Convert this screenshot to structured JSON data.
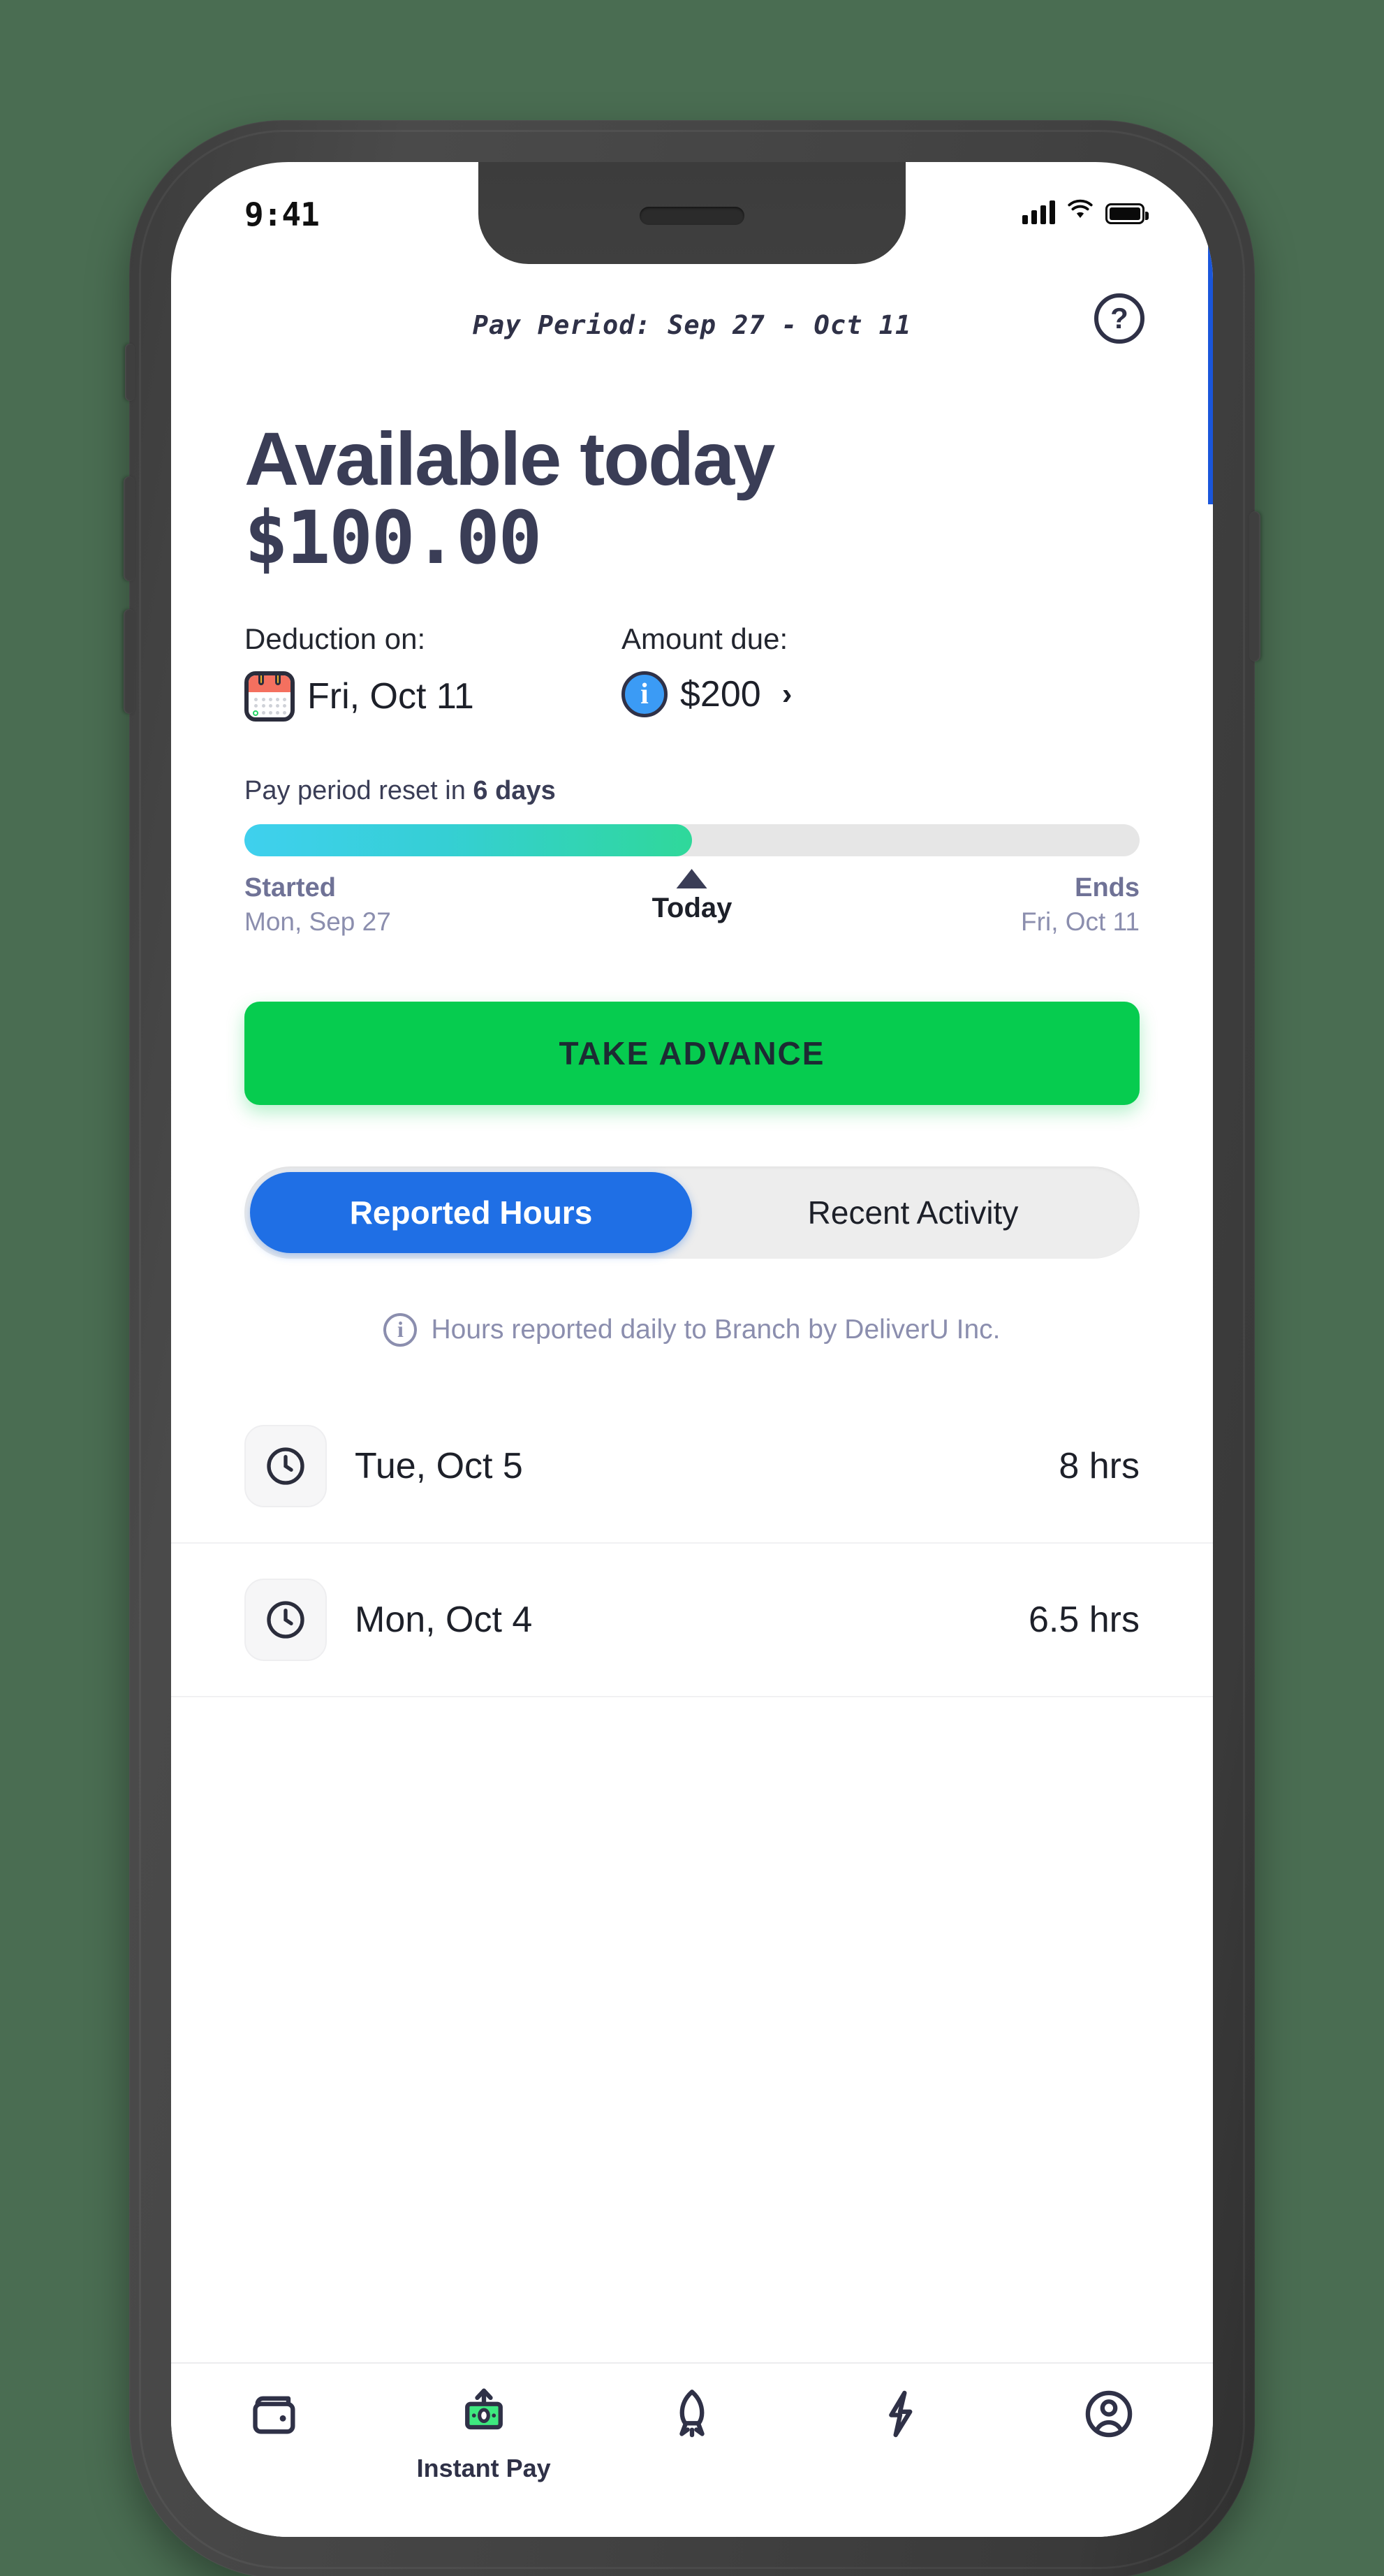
{
  "status_bar": {
    "time": "9:41",
    "signal_icon": "cellular-signal-icon",
    "wifi_icon": "wifi-icon",
    "battery_icon": "battery-full-icon"
  },
  "topbar": {
    "pay_period": "Pay Period: Sep 27 - Oct 11",
    "help_label": "?"
  },
  "headline": {
    "title": "Available today",
    "amount": "$100.00"
  },
  "meta": {
    "deduction_label": "Deduction on:",
    "deduction_value": "Fri, Oct 11",
    "amount_due_label": "Amount due:",
    "amount_due_value": "$200",
    "chevron": "›",
    "info_glyph": "i"
  },
  "progress": {
    "reset_prefix": "Pay period reset in ",
    "reset_days": "6 days",
    "percent": 50,
    "started_label": "Started",
    "started_date": "Mon, Sep 27",
    "today_label": "Today",
    "ends_label": "Ends",
    "ends_date": "Fri, Oct 11"
  },
  "primary_action": {
    "label": "TAKE ADVANCE"
  },
  "tabs": [
    {
      "label": "Reported Hours",
      "active": true
    },
    {
      "label": "Recent Activity",
      "active": false
    }
  ],
  "note": {
    "icon_glyph": "i",
    "text": "Hours reported daily to Branch by DeliverU Inc."
  },
  "hours": {
    "rows": [
      {
        "date": "Tue, Oct 5",
        "value": "8 hrs"
      },
      {
        "date": "Mon, Oct 4",
        "value": "6.5 hrs"
      }
    ]
  },
  "bottom_nav": {
    "items": [
      {
        "name": "wallet",
        "label": "",
        "active": false
      },
      {
        "name": "instant-pay",
        "label": "Instant Pay",
        "active": true
      },
      {
        "name": "rocket",
        "label": "",
        "active": false
      },
      {
        "name": "lightning",
        "label": "",
        "active": false
      },
      {
        "name": "profile",
        "label": "",
        "active": false
      }
    ]
  },
  "colors": {
    "background": "#4a6d52",
    "frame": "#434343",
    "navy": "#3a3d56",
    "green_cta": "#06cc4f",
    "blue_tab": "#1f6fe5",
    "blue_info": "#3b9bf5",
    "muted_purple": "#8b8eae",
    "progress_start": "#3fd0ee",
    "progress_end": "#2fd89a"
  }
}
